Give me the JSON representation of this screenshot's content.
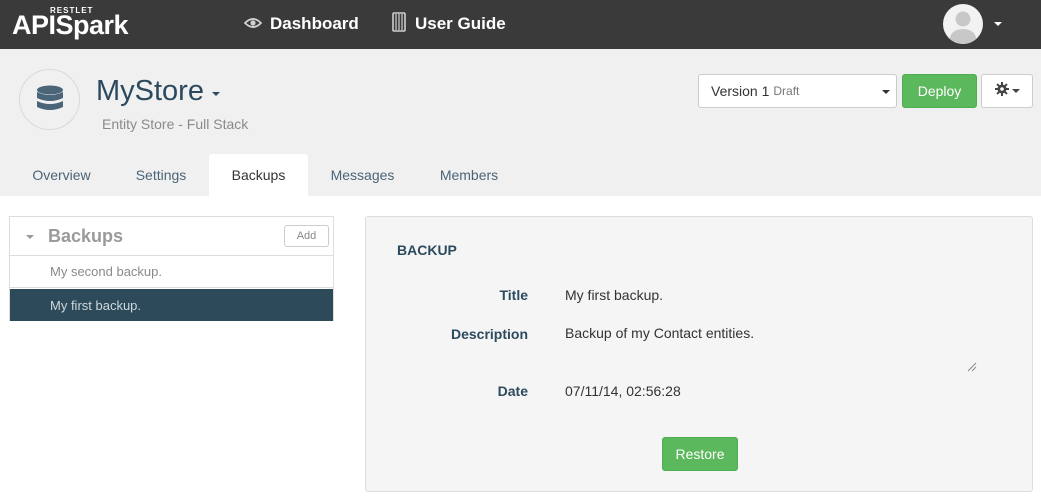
{
  "navbar": {
    "logo_small": "RESTLET",
    "logo_main": "APISpark",
    "dashboard_label": "Dashboard",
    "guide_label": "User Guide",
    "dashboard_icon": "eye-icon",
    "guide_icon": "book-icon"
  },
  "api": {
    "name": "MyStore",
    "subtitle": "Entity Store - Full Stack",
    "icon": "database-icon"
  },
  "version": {
    "label": "Version 1",
    "status": "Draft"
  },
  "actions": {
    "deploy_label": "Deploy",
    "settings_icon": "gear-icon"
  },
  "tabs": [
    {
      "label": "Overview"
    },
    {
      "label": "Settings"
    },
    {
      "label": "Backups",
      "active": true
    },
    {
      "label": "Messages"
    },
    {
      "label": "Members"
    }
  ],
  "backups_panel": {
    "title": "Backups",
    "add_label": "Add",
    "items": [
      {
        "label": "My second backup."
      },
      {
        "label": "My first backup.",
        "selected": true
      }
    ]
  },
  "detail": {
    "heading": "BACKUP",
    "title_label": "Title",
    "title_value": "My first backup.",
    "description_label": "Description",
    "description_value": "Backup of my Contact entities.",
    "date_label": "Date",
    "date_value": "07/11/14, 02:56:28",
    "restore_label": "Restore"
  },
  "colors": {
    "navbar_bg": "#3a3a3a",
    "header_bg": "#f0f0f0",
    "accent_green": "#5cb85c",
    "title_blue": "#2c4a5e",
    "selected_row": "#2c4a5a"
  }
}
